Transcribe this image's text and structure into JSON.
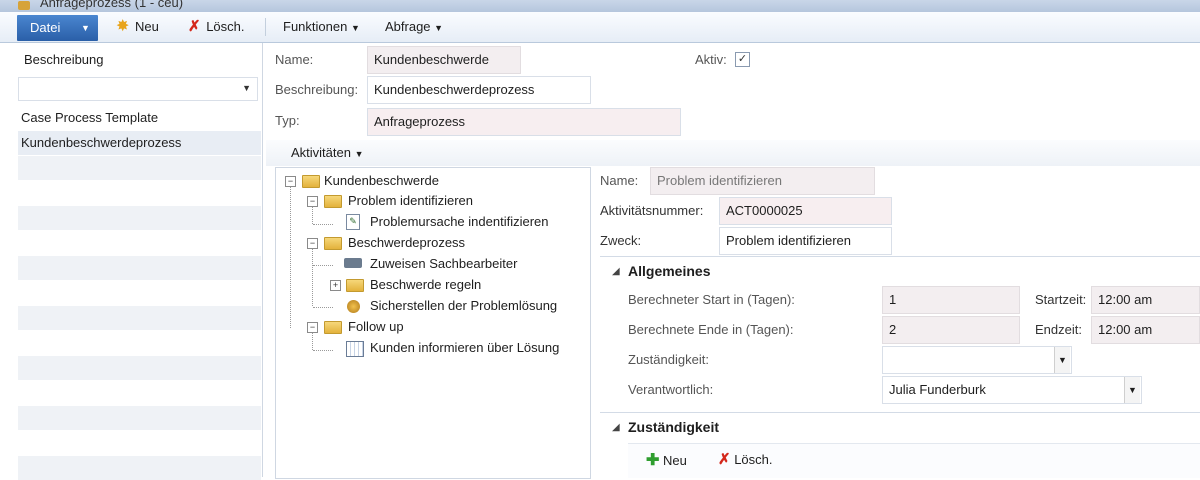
{
  "window": {
    "title": "Anfrageprozess (1 - ceu)"
  },
  "toolbar": {
    "datei": "Datei",
    "neu": "Neu",
    "loesch": "Lösch.",
    "funktionen": "Funktionen",
    "abfrage": "Abfrage"
  },
  "left": {
    "column_header": "Beschreibung",
    "filter_value": "",
    "rows": [
      "Case Process Template",
      "Kundenbeschwerdeprozess"
    ]
  },
  "form": {
    "name_label": "Name:",
    "name_value": "Kundenbeschwerde",
    "aktiv_label": "Aktiv:",
    "aktiv_checked": true,
    "beschreibung_label": "Beschreibung:",
    "beschreibung_value": "Kundenbeschwerdeprozess",
    "typ_label": "Typ:",
    "typ_value": "Anfrageprozess"
  },
  "aktivitaeten": {
    "menu_label": "Aktivitäten"
  },
  "tree": {
    "root": "Kundenbeschwerde",
    "nodes": [
      "Problem identifizieren",
      "Problemursache indentifizieren",
      "Beschwerdeprozess",
      "Zuweisen Sachbearbeiter",
      "Beschwerde regeln",
      "Sicherstellen der Problemlösung",
      "Follow up",
      "Kunden informieren über Lösung"
    ]
  },
  "detail": {
    "name_label": "Name:",
    "name_value": "Problem identifizieren",
    "nummer_label": "Aktivitätsnummer:",
    "nummer_value": "ACT0000025",
    "zweck_label": "Zweck:",
    "zweck_value": "Problem identifizieren"
  },
  "allgemeines": {
    "title": "Allgemeines",
    "start_label": "Berechneter Start in (Tagen):",
    "start_value": "1",
    "startzeit_label": "Startzeit:",
    "startzeit_value": "12:00 am",
    "ende_label": "Berechnete Ende in (Tagen):",
    "ende_value": "2",
    "endzeit_label": "Endzeit:",
    "endzeit_value": "12:00 am",
    "zustaendigkeit_label": "Zuständigkeit:",
    "zustaendigkeit_value": "",
    "verantwortlich_label": "Verantwortlich:",
    "verantwortlich_value": "Julia Funderburk"
  },
  "zustaendigkeit_section": {
    "title": "Zuständigkeit",
    "neu": "Neu",
    "loesch": "Lösch."
  },
  "colors": {
    "accent": "#2a5fa8",
    "readonly": "#f7eef0",
    "row_alt": "#eff2f6"
  },
  "icons": {
    "neu": "sun-star-icon",
    "loesch": "red-x-icon",
    "folder": "folder-icon",
    "plus": "green-plus-icon"
  }
}
